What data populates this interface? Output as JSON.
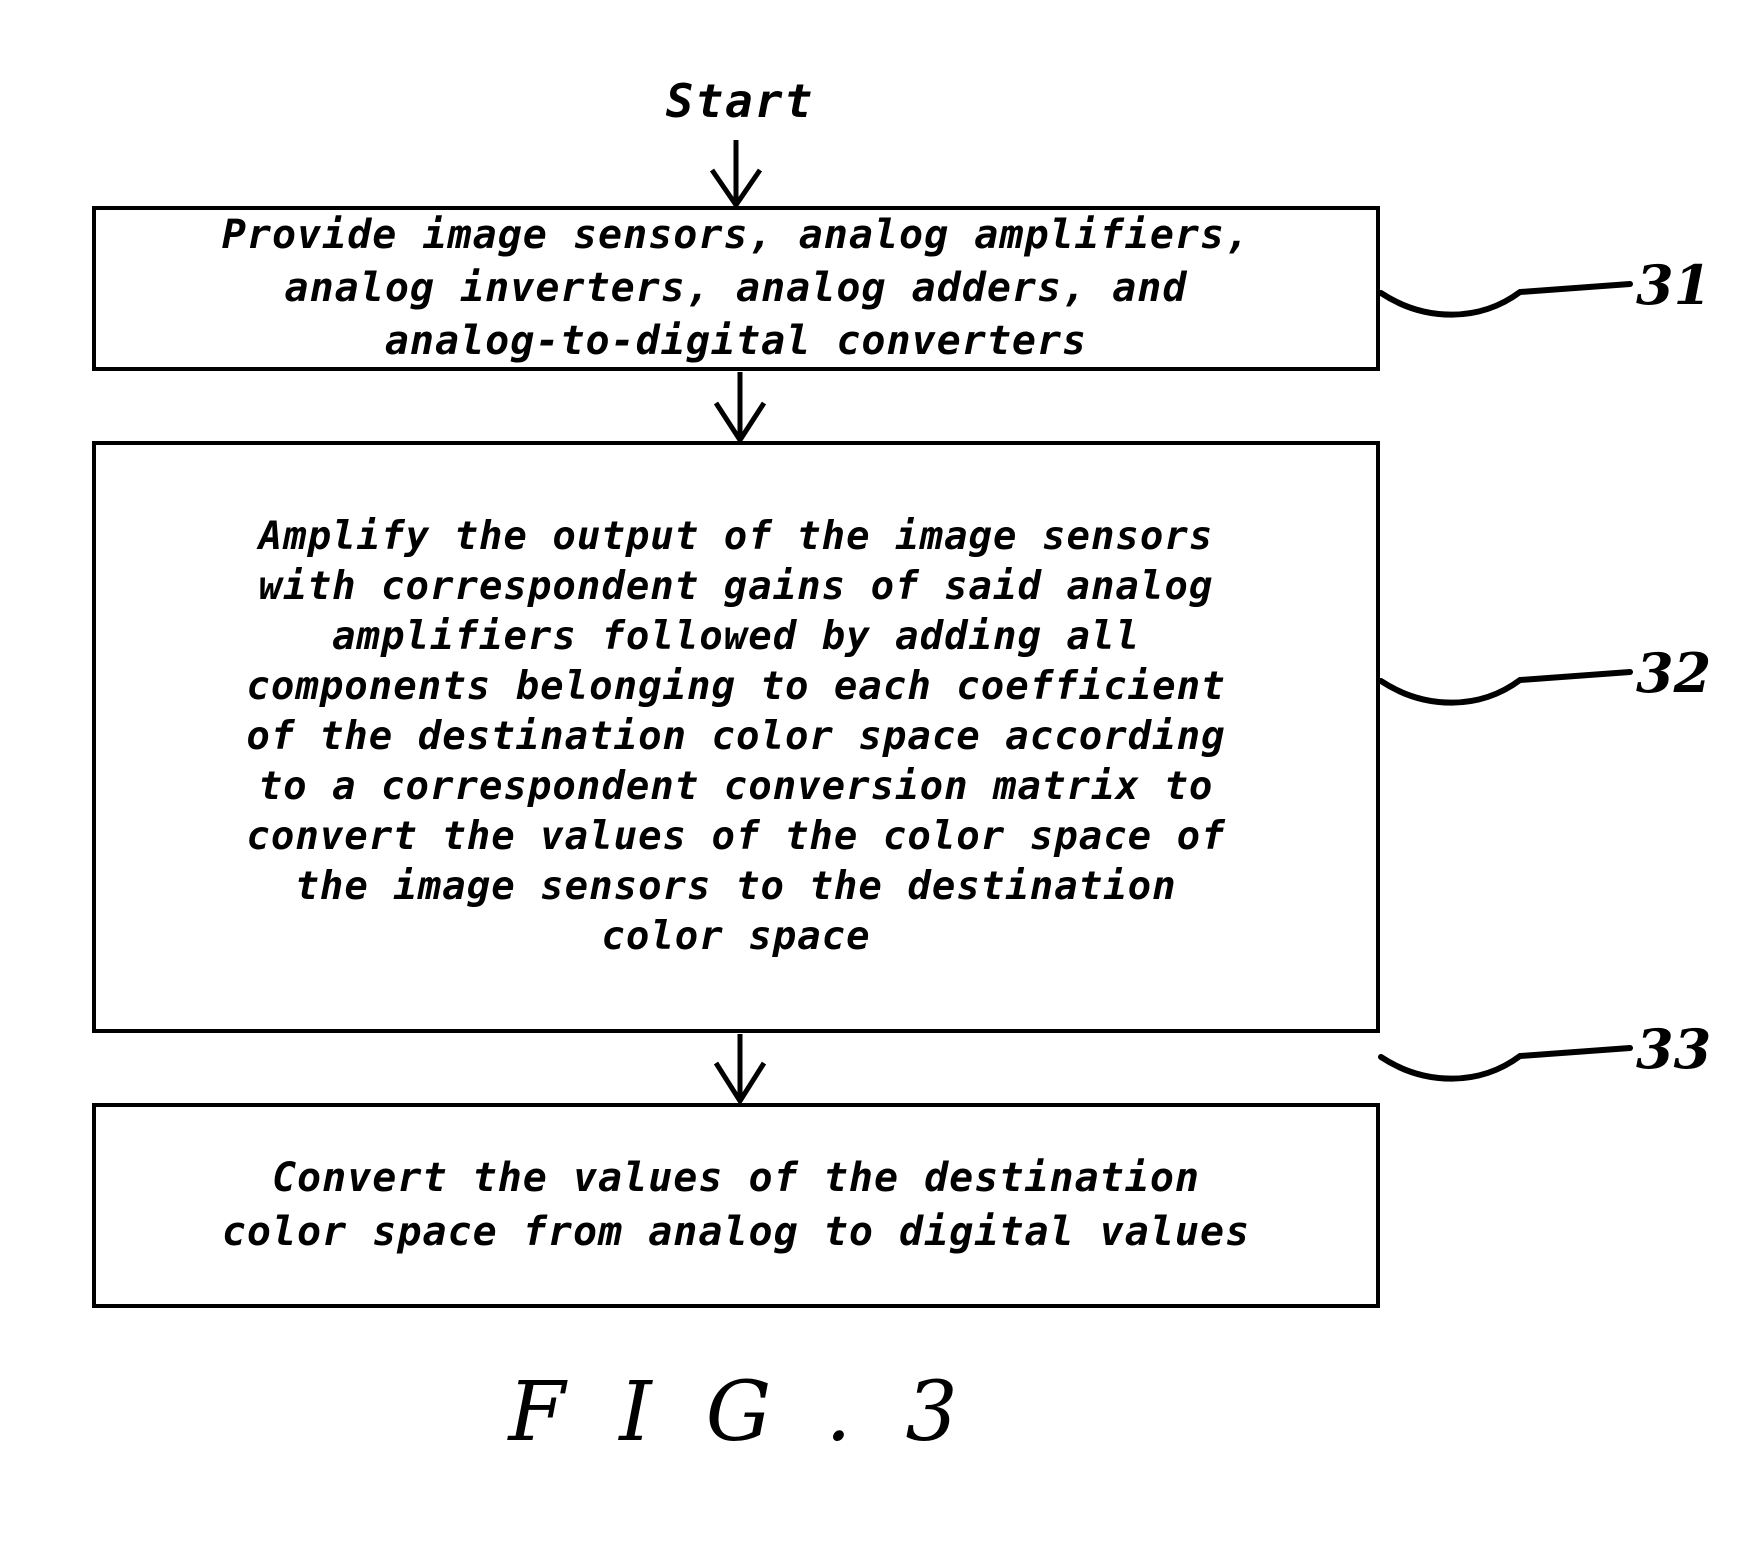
{
  "figure": {
    "caption": "F I G .  3",
    "start_label": "Start",
    "steps": [
      {
        "ref": "31",
        "text": "Provide image sensors, analog amplifiers,\nanalog inverters, analog adders, and\nanalog-to-digital converters"
      },
      {
        "ref": "32",
        "text": "Amplify the output of the image sensors\nwith correspondent gains of said analog\namplifiers followed by adding all\ncomponents belonging to each coefficient\nof the destination color space according\nto a correspondent conversion matrix to\nconvert the values of the color space of\nthe image sensors to the destination\ncolor space"
      },
      {
        "ref": "33",
        "text": "Convert the values of the destination\ncolor space from analog to digital values"
      }
    ],
    "ref_labels": {
      "step1": "31",
      "step2": "32",
      "step3": "33"
    },
    "colors": {
      "ink": "#000000",
      "paper": "#ffffff"
    }
  }
}
